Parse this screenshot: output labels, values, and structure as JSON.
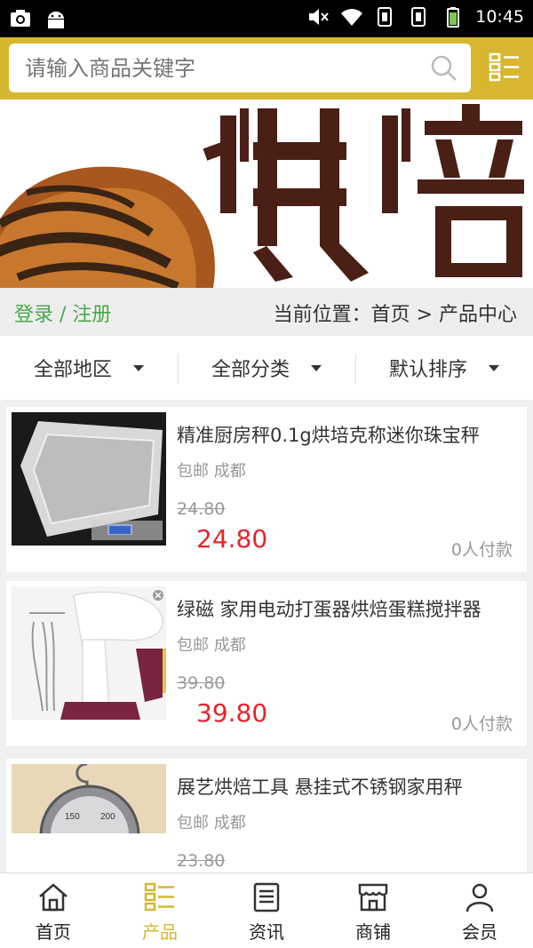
{
  "statusbar": {
    "time": "10:45"
  },
  "search": {
    "placeholder": "请输入商品关键字"
  },
  "breadcrumb": {
    "login": "登录 / 注册",
    "location": "当前位置：首页 > 产品中心"
  },
  "filters": [
    {
      "label": "全部地区"
    },
    {
      "label": "全部分类"
    },
    {
      "label": "默认排序"
    }
  ],
  "products": [
    {
      "title": "精准厨房秤0.1g烘培克称迷你珠宝秤",
      "shipping": "包邮 成都",
      "old_price": "24.80",
      "price": "24.80",
      "sold": "0人付款"
    },
    {
      "title": "绿磁 家用电动打蛋器烘焙蛋糕搅拌器",
      "shipping": "包邮 成都",
      "old_price": "39.80",
      "price": "39.80",
      "sold": "0人付款"
    },
    {
      "title": "展艺烘焙工具 悬挂式不锈钢家用秤",
      "shipping": "包邮 成都",
      "old_price": "23.80",
      "price": "",
      "sold": ""
    }
  ],
  "nav": [
    {
      "label": "首页",
      "icon": "home-icon"
    },
    {
      "label": "产品",
      "icon": "list-icon",
      "active": true
    },
    {
      "label": "资讯",
      "icon": "news-icon"
    },
    {
      "label": "商铺",
      "icon": "shop-icon"
    },
    {
      "label": "会员",
      "icon": "user-icon"
    }
  ],
  "colors": {
    "brand": "#d7b730",
    "price": "#e8232b",
    "login": "#4aa84a"
  }
}
